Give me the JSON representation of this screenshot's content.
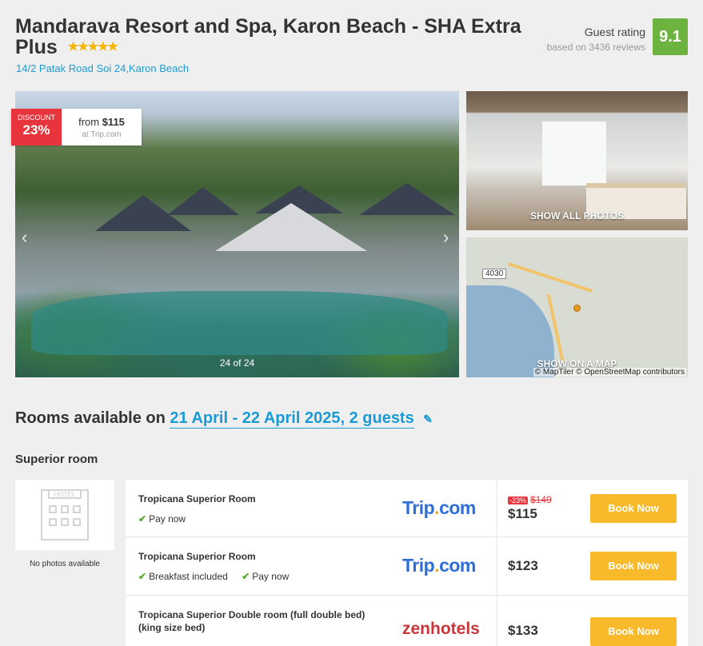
{
  "hotel": {
    "name": "Mandarava Resort and Spa, Karon Beach - SHA Extra Plus",
    "stars": "★★★★★",
    "address": "14/2 Patak Road Soi 24,Karon Beach"
  },
  "rating": {
    "label": "Guest rating",
    "reviews": "based on 3436 reviews",
    "score": "9.1",
    "badge_color": "#6db33f"
  },
  "gallery": {
    "counter": "24 of 24",
    "prev_icon": "‹",
    "next_icon": "›",
    "show_all_label": "SHOW ALL PHOTOS"
  },
  "deal": {
    "tag_label": "DISCOUNT",
    "percent": "23%",
    "from_prefix": "from",
    "from_price": "$115",
    "source": "at Trip.com"
  },
  "map": {
    "road_number": "4030",
    "show_label": "SHOW ON A MAP",
    "credit": "© MapTiler © OpenStreetMap contributors"
  },
  "rooms": {
    "heading_prefix": "Rooms available on",
    "dates": "21 April - 22 April 2025, 2 guests",
    "edit_icon": "✎",
    "room_type": "Superior room",
    "no_photos": "No photos available",
    "hotel_sign": "HOTEL",
    "offers": [
      {
        "name": "Tropicana Superior Room",
        "perks": [
          "Pay now"
        ],
        "provider_main": "Trip",
        "provider_dot": ".",
        "provider_suffix": "com",
        "discount": "-23%",
        "old_price": "$149",
        "price": "$115",
        "button": "Book Now"
      },
      {
        "name": "Tropicana Superior Room",
        "perks": [
          "Breakfast included",
          "Pay now"
        ],
        "provider_main": "Trip",
        "provider_dot": ".",
        "provider_suffix": "com",
        "price": "$123",
        "button": "Book Now"
      },
      {
        "name": "Tropicana Superior Double room (full double bed) (king size bed)",
        "perks": [],
        "provider_name": "zenhotels",
        "price": "$133",
        "button": "Book Now"
      }
    ],
    "check_icon": "✔",
    "brand_colors": {
      "trip": "#2d6fd9",
      "zen": "#c9363a",
      "button": "#f8b92a",
      "discount": "#e8343c"
    }
  }
}
